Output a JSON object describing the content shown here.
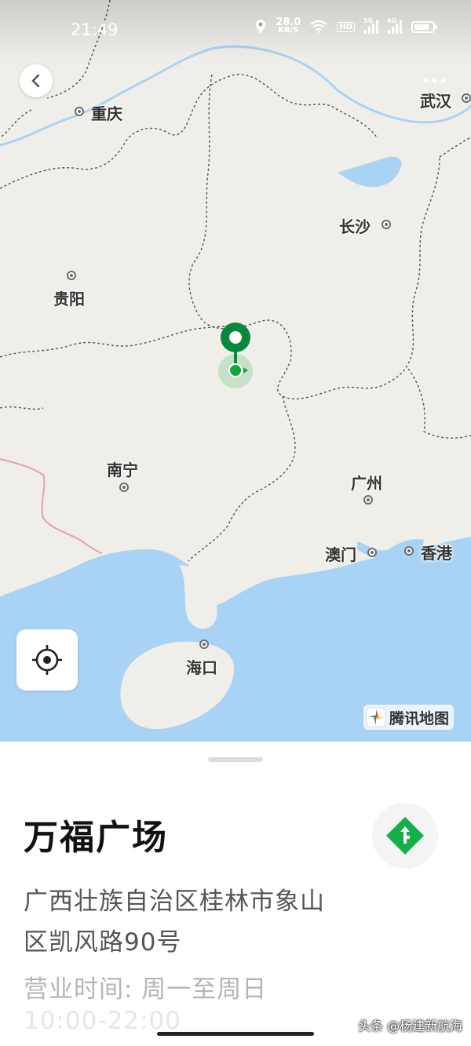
{
  "status_bar": {
    "time": "21:49",
    "net_speed_value": "28.0",
    "net_speed_unit": "KB/S",
    "hd_label": "HD",
    "signal1_label": "5G",
    "signal2_label": "4G",
    "icons": [
      "location-icon",
      "wifi-icon",
      "battery-icon"
    ]
  },
  "map": {
    "cities": [
      {
        "name": "重庆"
      },
      {
        "name": "武汉"
      },
      {
        "name": "长沙"
      },
      {
        "name": "贵阳"
      },
      {
        "name": "南宁"
      },
      {
        "name": "广州"
      },
      {
        "name": "澳门"
      },
      {
        "name": "香港"
      },
      {
        "name": "海口"
      }
    ],
    "provider_logo": "腾讯地图",
    "colors": {
      "land": "#efeee9",
      "water": "#a9d3f5",
      "marker": "#07883d",
      "user_dot": "#12a838"
    }
  },
  "place": {
    "name": "万福广场",
    "address": "广西壮族自治区桂林市象山区凯风路90号",
    "hours": "营业时间: 周一至周日",
    "hours_detail": "10:00-22:00"
  },
  "watermark": "头条 @杨建新航海",
  "accent_color": "#13b04a"
}
